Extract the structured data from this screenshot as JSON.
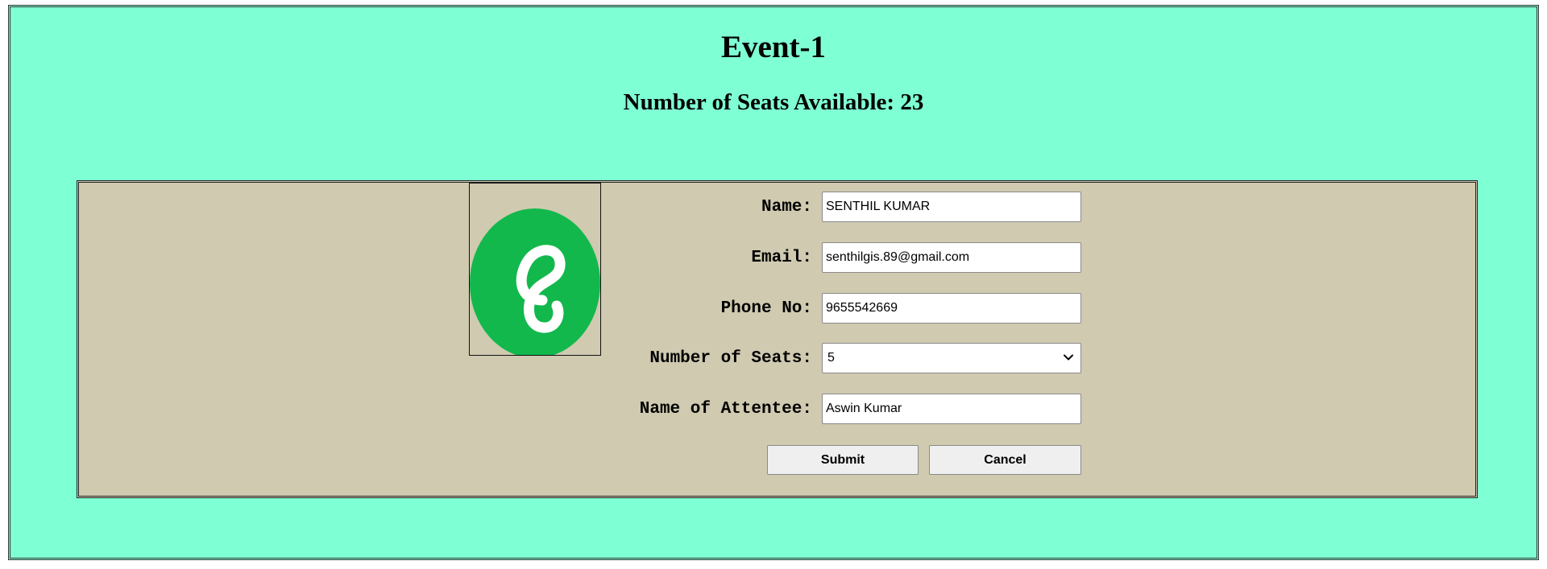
{
  "header": {
    "title": "Event-1",
    "seats_label": "Number of Seats Available: 23"
  },
  "logo": {
    "icon": "green-circle-logo",
    "colors": {
      "circle": "#12b84c",
      "glyph": "#ffffff"
    }
  },
  "form": {
    "fields": [
      {
        "label": "Name:",
        "value": "SENTHIL KUMAR"
      },
      {
        "label": "Email:",
        "value": "senthilgis.89@gmail.com"
      },
      {
        "label": "Phone No:",
        "value": "9655542669"
      },
      {
        "label": "Number of Seats:",
        "value": "5"
      },
      {
        "label": "Name of Attentee:",
        "value": "Aswin Kumar"
      }
    ],
    "submit_label": "Submit",
    "cancel_label": "Cancel"
  },
  "colors": {
    "page_background": "#7fffd4",
    "panel_background": "#cfcab0",
    "button_background": "#efefef"
  }
}
